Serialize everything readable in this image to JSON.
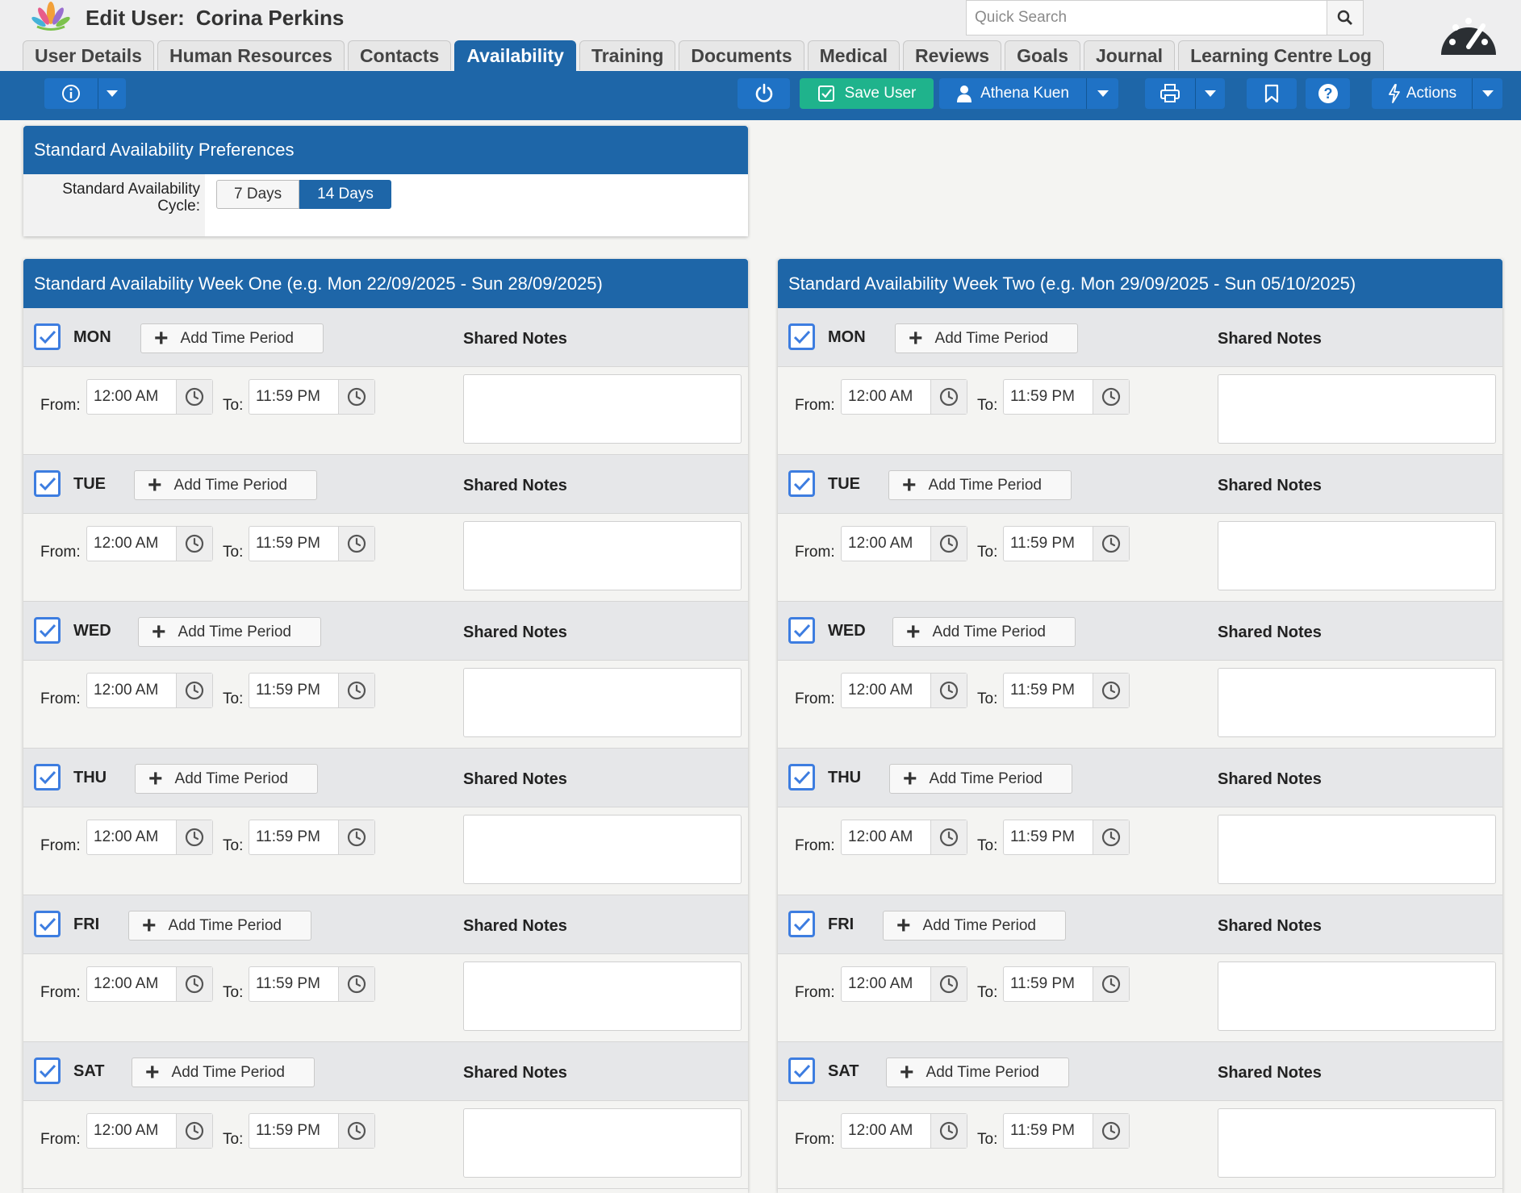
{
  "header": {
    "title_label": "Edit User:",
    "user_name": "Corina Perkins",
    "search_placeholder": "Quick Search"
  },
  "tabs": [
    {
      "label": "User Details"
    },
    {
      "label": "Human Resources"
    },
    {
      "label": "Contacts"
    },
    {
      "label": "Availability",
      "active": true
    },
    {
      "label": "Training"
    },
    {
      "label": "Documents"
    },
    {
      "label": "Medical"
    },
    {
      "label": "Reviews"
    },
    {
      "label": "Goals"
    },
    {
      "label": "Journal"
    },
    {
      "label": "Learning Centre Log"
    }
  ],
  "toolbar": {
    "save_label": "Save User",
    "user_label": "Athena Kuen",
    "actions_label": "Actions"
  },
  "preferences": {
    "title": "Standard Availability Preferences",
    "cycle_label": "Standard Availability Cycle:",
    "options": [
      "7 Days",
      "14 Days"
    ],
    "selected": "14 Days"
  },
  "labels": {
    "add_time_period": "Add Time Period",
    "shared_notes": "Shared Notes",
    "from": "From:",
    "to": "To:"
  },
  "weeks": [
    {
      "title": "Standard Availability Week One (e.g. Mon 22/09/2025 - Sun 28/09/2025)",
      "days": [
        {
          "name": "MON",
          "checked": true,
          "from": "12:00 AM",
          "to": "11:59 PM",
          "notes": ""
        },
        {
          "name": "TUE",
          "checked": true,
          "from": "12:00 AM",
          "to": "11:59 PM",
          "notes": ""
        },
        {
          "name": "WED",
          "checked": true,
          "from": "12:00 AM",
          "to": "11:59 PM",
          "notes": ""
        },
        {
          "name": "THU",
          "checked": true,
          "from": "12:00 AM",
          "to": "11:59 PM",
          "notes": ""
        },
        {
          "name": "FRI",
          "checked": true,
          "from": "12:00 AM",
          "to": "11:59 PM",
          "notes": ""
        },
        {
          "name": "SAT",
          "checked": true,
          "from": "12:00 AM",
          "to": "11:59 PM",
          "notes": ""
        }
      ]
    },
    {
      "title": "Standard Availability Week Two (e.g. Mon 29/09/2025 - Sun 05/10/2025)",
      "days": [
        {
          "name": "MON",
          "checked": true,
          "from": "12:00 AM",
          "to": "11:59 PM",
          "notes": ""
        },
        {
          "name": "TUE",
          "checked": true,
          "from": "12:00 AM",
          "to": "11:59 PM",
          "notes": ""
        },
        {
          "name": "WED",
          "checked": true,
          "from": "12:00 AM",
          "to": "11:59 PM",
          "notes": ""
        },
        {
          "name": "THU",
          "checked": true,
          "from": "12:00 AM",
          "to": "11:59 PM",
          "notes": ""
        },
        {
          "name": "FRI",
          "checked": true,
          "from": "12:00 AM",
          "to": "11:59 PM",
          "notes": ""
        },
        {
          "name": "SAT",
          "checked": true,
          "from": "12:00 AM",
          "to": "11:59 PM",
          "notes": ""
        }
      ]
    }
  ],
  "colors": {
    "brand_blue": "#1e66a8",
    "button_blue": "#1f72c5",
    "save_green": "#1fb38c",
    "checkbox_blue": "#3d7de0"
  }
}
